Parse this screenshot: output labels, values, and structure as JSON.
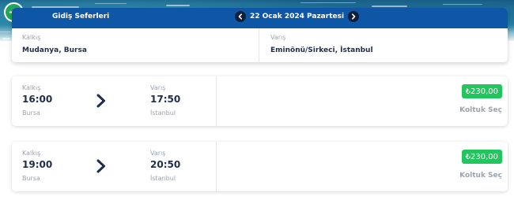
{
  "header": {
    "title": "Gidiş Seferleri",
    "date": "22 Ocak 2024 Pazartesi"
  },
  "route": {
    "departure_label": "Kalkış",
    "departure_value": "Mudanya, Bursa",
    "arrival_label": "Varış",
    "arrival_value": "Eminönü/Sirkeci, İstanbul"
  },
  "trips": [
    {
      "dep_label": "Kalkış",
      "dep_time": "16:00",
      "dep_city": "Bursa",
      "arr_label": "Varış",
      "arr_time": "17:50",
      "arr_city": "İstanbul",
      "price": "₺230,00",
      "action": "Koltuk Seç"
    },
    {
      "dep_label": "Kalkış",
      "dep_time": "19:00",
      "dep_city": "Bursa",
      "arr_label": "Varış",
      "arr_time": "20:50",
      "arr_city": "İstanbul",
      "price": "₺230,00",
      "action": "Koltuk Seç"
    }
  ],
  "colors": {
    "header_blue": "#0e56a6",
    "price_green": "#22c55e",
    "back_green": "#22a65a",
    "text_dark": "#1f2d4a",
    "text_muted": "#9aa3b0"
  }
}
